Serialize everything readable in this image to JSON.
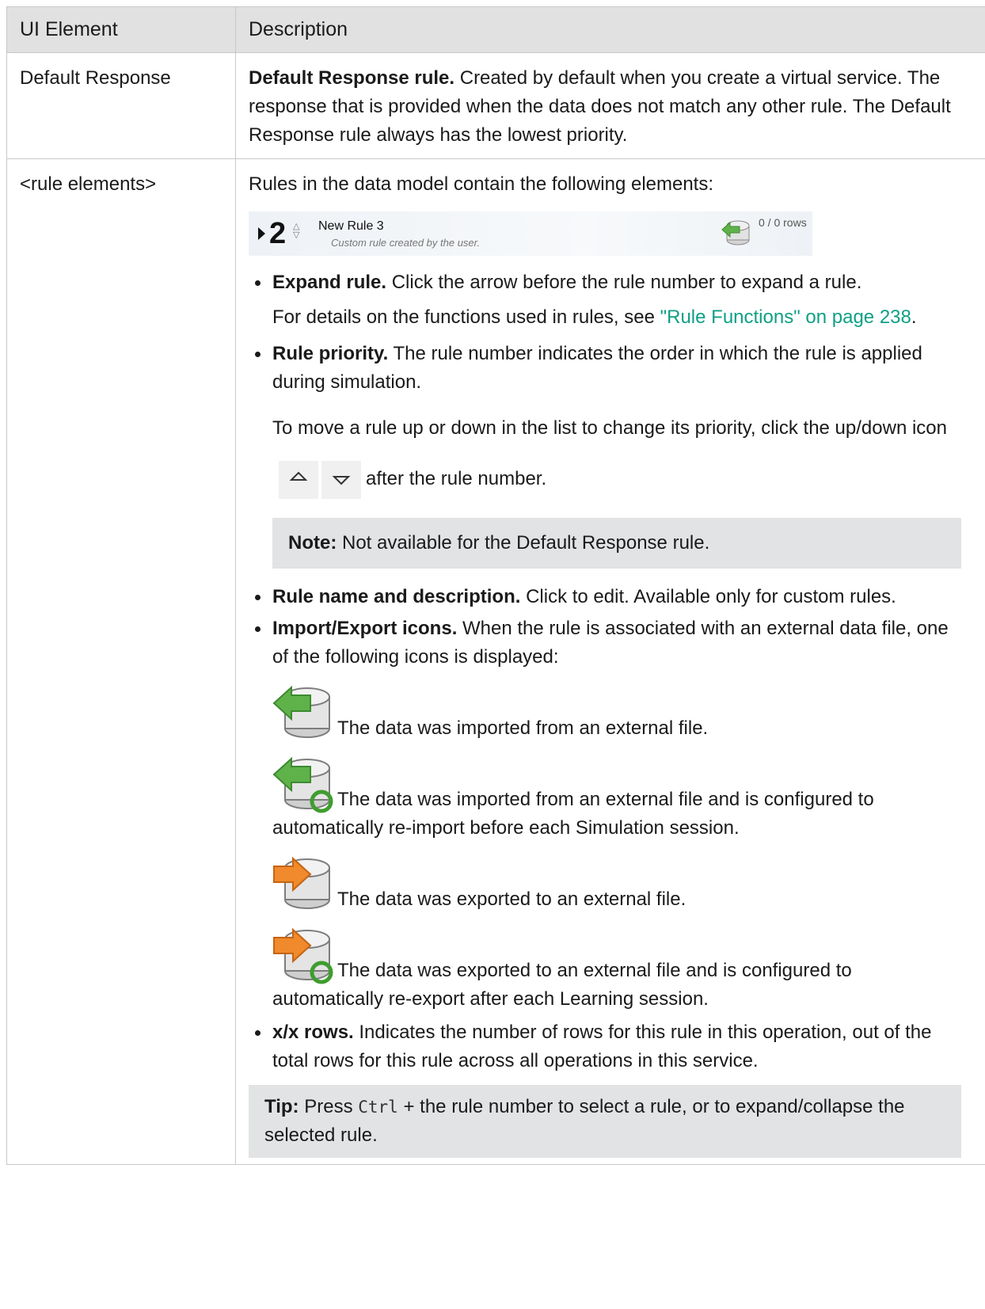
{
  "table": {
    "headers": [
      "UI Element",
      "Description"
    ],
    "row1": {
      "name": "Default Response",
      "lead": "Default Response rule.",
      "text": " Created by default when you create a virtual service. The response that is provided when the data does not match any other rule. The Default Response rule always has the lowest priority."
    },
    "row2": {
      "name": "<rule elements>",
      "intro": "Rules in the data model contain the following elements:",
      "strip": {
        "number": "2",
        "rule_name": "New Rule 3",
        "rule_desc": "Custom rule created by the user.",
        "rows": "0 / 0 rows"
      },
      "expand": {
        "lead": "Expand rule.",
        "text": " Click the arrow before the rule number to expand a rule.",
        "details_pre": "For details on the functions used in rules, see ",
        "link": "\"Rule Functions\" on page 238",
        "details_post": "."
      },
      "priority": {
        "lead": "Rule priority.",
        "text": " The rule number indicates the order in which the rule is applied during simulation.",
        "move_pre": "To move a rule up or down in the list to change its priority, click the up/down icon",
        "move_post": "after the rule number.",
        "note_label": "Note:",
        "note_text": " Not available for the Default Response rule."
      },
      "name_desc": {
        "lead": "Rule name and description.",
        "text": " Click to edit. Available only for custom rules."
      },
      "import_export": {
        "lead": "Import/Export icons.",
        "text": " When the rule is associated with an external data file, one of the following icons is displayed:",
        "icons": [
          {
            "icon": "database-import-icon",
            "text": "The data was imported from an external file."
          },
          {
            "icon": "database-import-auto-icon",
            "text": "The data was imported from an external file and is configured to automatically re-import before each Simulation session."
          },
          {
            "icon": "database-export-icon",
            "text": "The data was exported to an external file."
          },
          {
            "icon": "database-export-auto-icon",
            "text": "The data was exported to an external file and is configured to automatically re-export after each Learning session."
          }
        ]
      },
      "rows_item": {
        "lead": "x/x rows.",
        "text": " Indicates the number of rows for this rule in this operation, out of the total rows for this rule across all operations in this service."
      },
      "tip": {
        "label": "Tip:",
        "pre": " Press ",
        "key": "Ctrl",
        "post": " + the rule number to select a rule, or to expand/collapse the selected rule."
      }
    }
  },
  "colors": {
    "link": "#0f9f86",
    "header_bg": "#e1e1e1",
    "note_bg": "#e1e3e4",
    "import_green": "#5fb24a",
    "export_orange": "#f08a2c"
  }
}
